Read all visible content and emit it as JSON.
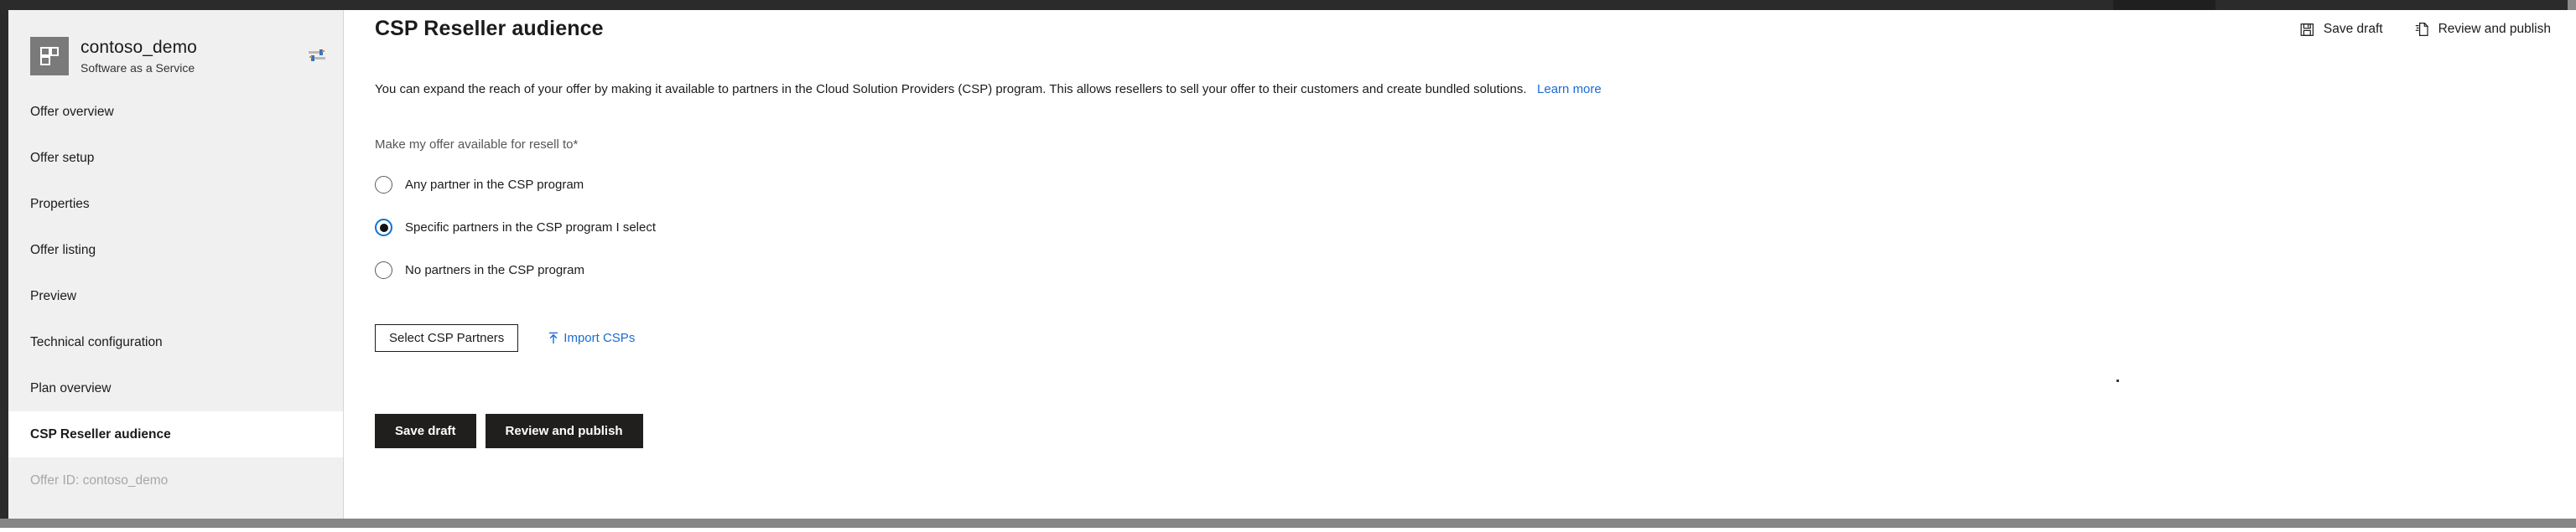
{
  "window": {
    "accent_blue": "#1a6bd6",
    "radio_accent": "#0a74d4",
    "button_dark": "#201f1e",
    "sidebar_bg": "#f0f0f0"
  },
  "sidebar": {
    "brand": {
      "title": "contoso_demo",
      "subtitle": "Software as a Service",
      "logo_icon": "grid-squares-icon",
      "switch_icon": "sliders-switch-icon"
    },
    "items": [
      {
        "label": "Offer overview",
        "selected": false,
        "muted": false
      },
      {
        "label": "Offer setup",
        "selected": false,
        "muted": false
      },
      {
        "label": "Properties",
        "selected": false,
        "muted": false
      },
      {
        "label": "Offer listing",
        "selected": false,
        "muted": false
      },
      {
        "label": "Preview",
        "selected": false,
        "muted": false
      },
      {
        "label": "Technical configuration",
        "selected": false,
        "muted": false
      },
      {
        "label": "Plan overview",
        "selected": false,
        "muted": false
      },
      {
        "label": "CSP Reseller audience",
        "selected": true,
        "muted": false
      },
      {
        "label": "Offer ID: contoso_demo",
        "selected": false,
        "muted": true
      }
    ]
  },
  "header": {
    "title": "CSP Reseller audience",
    "actions": [
      {
        "label": "Save draft",
        "icon": "save-floppy-icon"
      },
      {
        "label": "Review and publish",
        "icon": "publish-document-icon"
      }
    ]
  },
  "main": {
    "description": "You can expand the reach of your offer by making it available to partners in the Cloud Solution Providers (CSP) program. This allows resellers to sell your offer to their customers and create bundled solutions.",
    "learn_more": "Learn more",
    "field_label": "Make my offer available for resell to*",
    "radio_options": [
      {
        "label": "Any partner in the CSP program",
        "checked": false
      },
      {
        "label": "Specific partners in the CSP program I select",
        "checked": true
      },
      {
        "label": "No partners in the CSP program",
        "checked": false
      }
    ],
    "select_partners_button": "Select CSP Partners",
    "import_link": "Import CSPs",
    "import_icon": "upload-arrow-icon",
    "footer_buttons": [
      {
        "label": "Save draft"
      },
      {
        "label": "Review and publish"
      }
    ]
  }
}
